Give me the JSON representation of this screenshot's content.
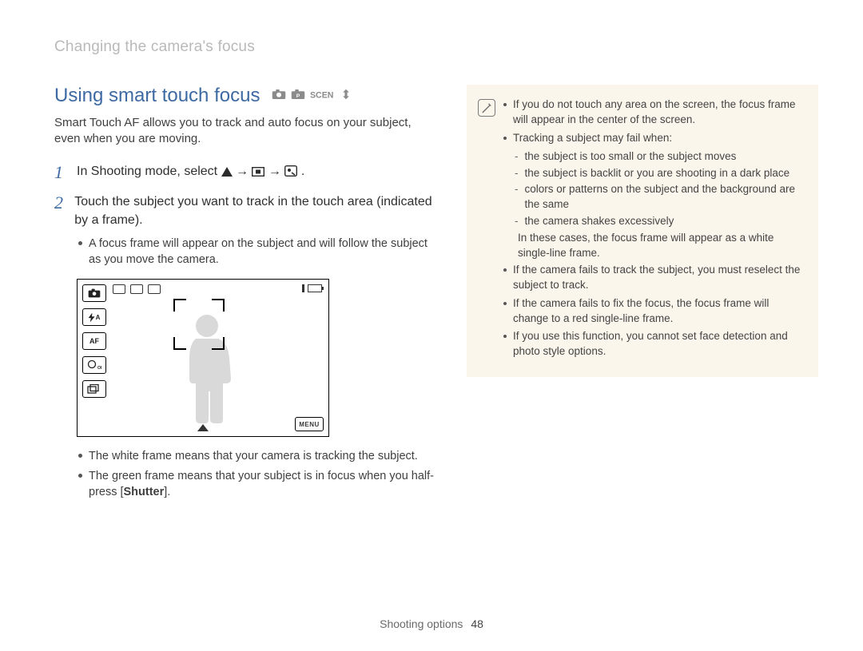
{
  "breadcrumb": "Changing the camera's focus",
  "section_title": "Using smart touch focus",
  "mode_icons": [
    "camera-auto-icon",
    "camera-p-icon",
    "scene-text-icon",
    "dual-is-icon"
  ],
  "intro": "Smart Touch AF allows you to track and auto focus on your subject, even when you are moving.",
  "steps": [
    {
      "num": "1",
      "text_pre": "In Shooting mode, select ",
      "text_post": "."
    },
    {
      "num": "2",
      "text": "Touch the subject you want to track in the touch area (indicated by a frame)."
    }
  ],
  "step2_sub": "A focus frame will appear on the subject and will follow the subject as you move the camera.",
  "screenshot": {
    "left_buttons": [
      "cam",
      "flash-a",
      "AF",
      "off",
      "burst"
    ],
    "af_label": "AF",
    "off_label": "OFF",
    "menu_label": "MENU"
  },
  "post_bullets": [
    "The white frame means that your camera is tracking the subject.",
    "The green frame means that your subject is in focus when you half-press [Shutter]."
  ],
  "note": {
    "items": [
      {
        "text": "If you do not touch any area on the screen, the focus frame will appear in the center of the screen."
      },
      {
        "text": "Tracking a subject may fail when:",
        "subs": [
          "the subject is too small or the subject moves",
          "the subject is backlit or you are shooting in a dark place",
          "colors or patterns on the subject and the background are the same",
          "the camera shakes excessively"
        ],
        "tail": "In these cases, the focus frame will appear as a white single-line frame."
      },
      {
        "text": "If the camera fails to track the subject, you must reselect the subject to track."
      },
      {
        "text": "If the camera fails to fix the focus, the focus frame will change to a red single-line frame."
      },
      {
        "text": "If you use this function, you cannot set face detection and photo style options."
      }
    ]
  },
  "footer_label": "Shooting options",
  "footer_page": "48"
}
